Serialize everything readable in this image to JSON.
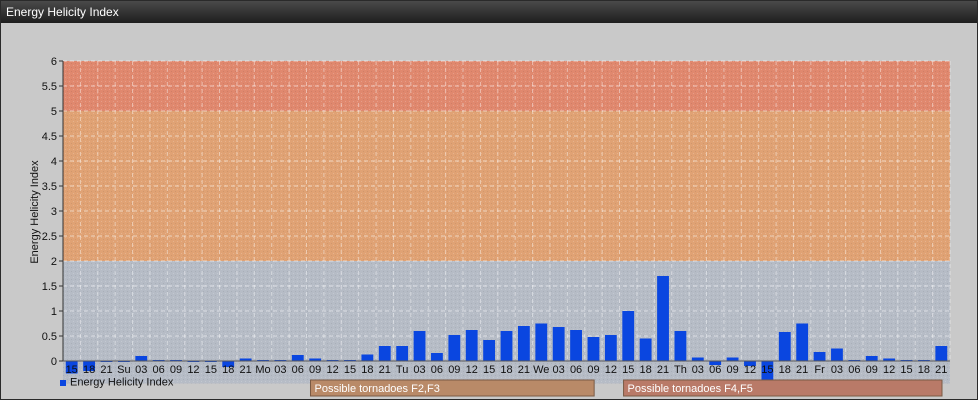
{
  "window": {
    "title": "Energy Helicity Index"
  },
  "chart_data": {
    "type": "bar",
    "ylabel": "Energy Helicity Index",
    "ylim": [
      -0.45,
      6
    ],
    "yticks": [
      "0",
      "0.5",
      "1",
      "1.5",
      "2",
      "2.5",
      "3",
      "3.5",
      "4",
      "4.5",
      "5",
      "5.5",
      "6"
    ],
    "categories": [
      "15",
      "18",
      "21",
      "Su",
      "03",
      "06",
      "09",
      "12",
      "15",
      "18",
      "21",
      "Mo",
      "03",
      "06",
      "09",
      "12",
      "15",
      "18",
      "21",
      "Tu",
      "03",
      "06",
      "09",
      "12",
      "15",
      "18",
      "21",
      "We",
      "03",
      "06",
      "09",
      "12",
      "15",
      "18",
      "21",
      "Th",
      "03",
      "06",
      "09",
      "12",
      "15",
      "18",
      "21",
      "Fr",
      "03",
      "06",
      "09",
      "12",
      "15",
      "18",
      "21"
    ],
    "series": [
      {
        "name": "Energy Helicity Index",
        "color": "#0a46e0",
        "values": [
          -0.25,
          -0.2,
          -0.02,
          -0.02,
          0.1,
          0.02,
          0.02,
          -0.02,
          -0.02,
          -0.12,
          0.05,
          0.02,
          0.02,
          0.12,
          0.05,
          0.02,
          0.02,
          0.13,
          0.3,
          0.3,
          0.6,
          0.16,
          0.52,
          0.62,
          0.42,
          0.6,
          0.7,
          0.75,
          0.68,
          0.62,
          0.48,
          0.52,
          1.0,
          0.45,
          1.7,
          0.6,
          0.07,
          -0.08,
          0.07,
          -0.1,
          -0.45,
          0.58,
          0.75,
          0.18,
          0.25,
          0.02,
          0.1,
          0.05,
          0.02,
          0.02,
          0.3
        ]
      }
    ],
    "bands": [
      {
        "from": 0,
        "to": 2,
        "color": "#b6bcc6"
      },
      {
        "from": 2,
        "to": 5,
        "color": "#e0a274"
      },
      {
        "from": 5,
        "to": 6,
        "color": "#e0886e"
      }
    ],
    "annotations": [
      {
        "label": "Possible tornadoes F2,F3",
        "from_category": 14,
        "to_category": 30,
        "color": "#b98a68"
      },
      {
        "label": "Possible tornadoes F4,F5",
        "from_category": 32,
        "to_category": 50,
        "color": "#b97a68"
      }
    ],
    "legend": {
      "position": "bottom-left",
      "label": "Energy Helicity Index"
    },
    "grid": true
  }
}
